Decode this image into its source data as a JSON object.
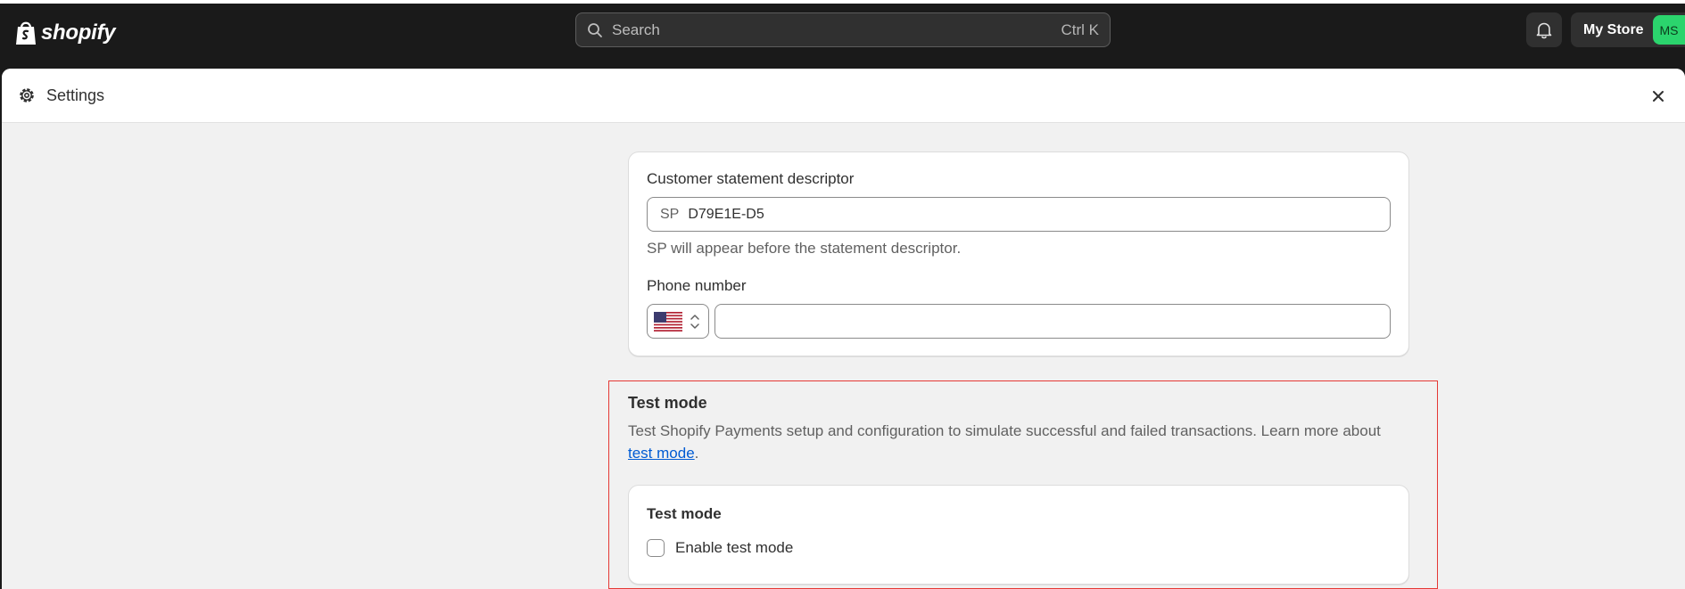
{
  "topbar": {
    "logo_text": "shopify",
    "search_placeholder": "Search",
    "search_shortcut": "Ctrl K",
    "store_name": "My Store",
    "avatar_initials": "MS"
  },
  "modal": {
    "title": "Settings"
  },
  "descriptor_card": {
    "descriptor_label": "Customer statement descriptor",
    "descriptor_prefix": "SP",
    "descriptor_value": "D79E1E-D5",
    "descriptor_help": "SP will appear before the statement descriptor.",
    "phone_label": "Phone number",
    "phone_value": ""
  },
  "test_mode": {
    "section_title": "Test mode",
    "description_before": "Test Shopify Payments setup and configuration to simulate successful and failed transactions. Learn more about ",
    "link_text": "test mode",
    "description_after": ".",
    "card_title": "Test mode",
    "checkbox_label": "Enable test mode",
    "checkbox_checked": false
  },
  "colors": {
    "topbar_bg": "#1a1a1a",
    "modal_bg": "#f1f1f1",
    "link": "#005bd3",
    "highlight": "#e53935",
    "avatar_bg": "#2bd46d"
  }
}
